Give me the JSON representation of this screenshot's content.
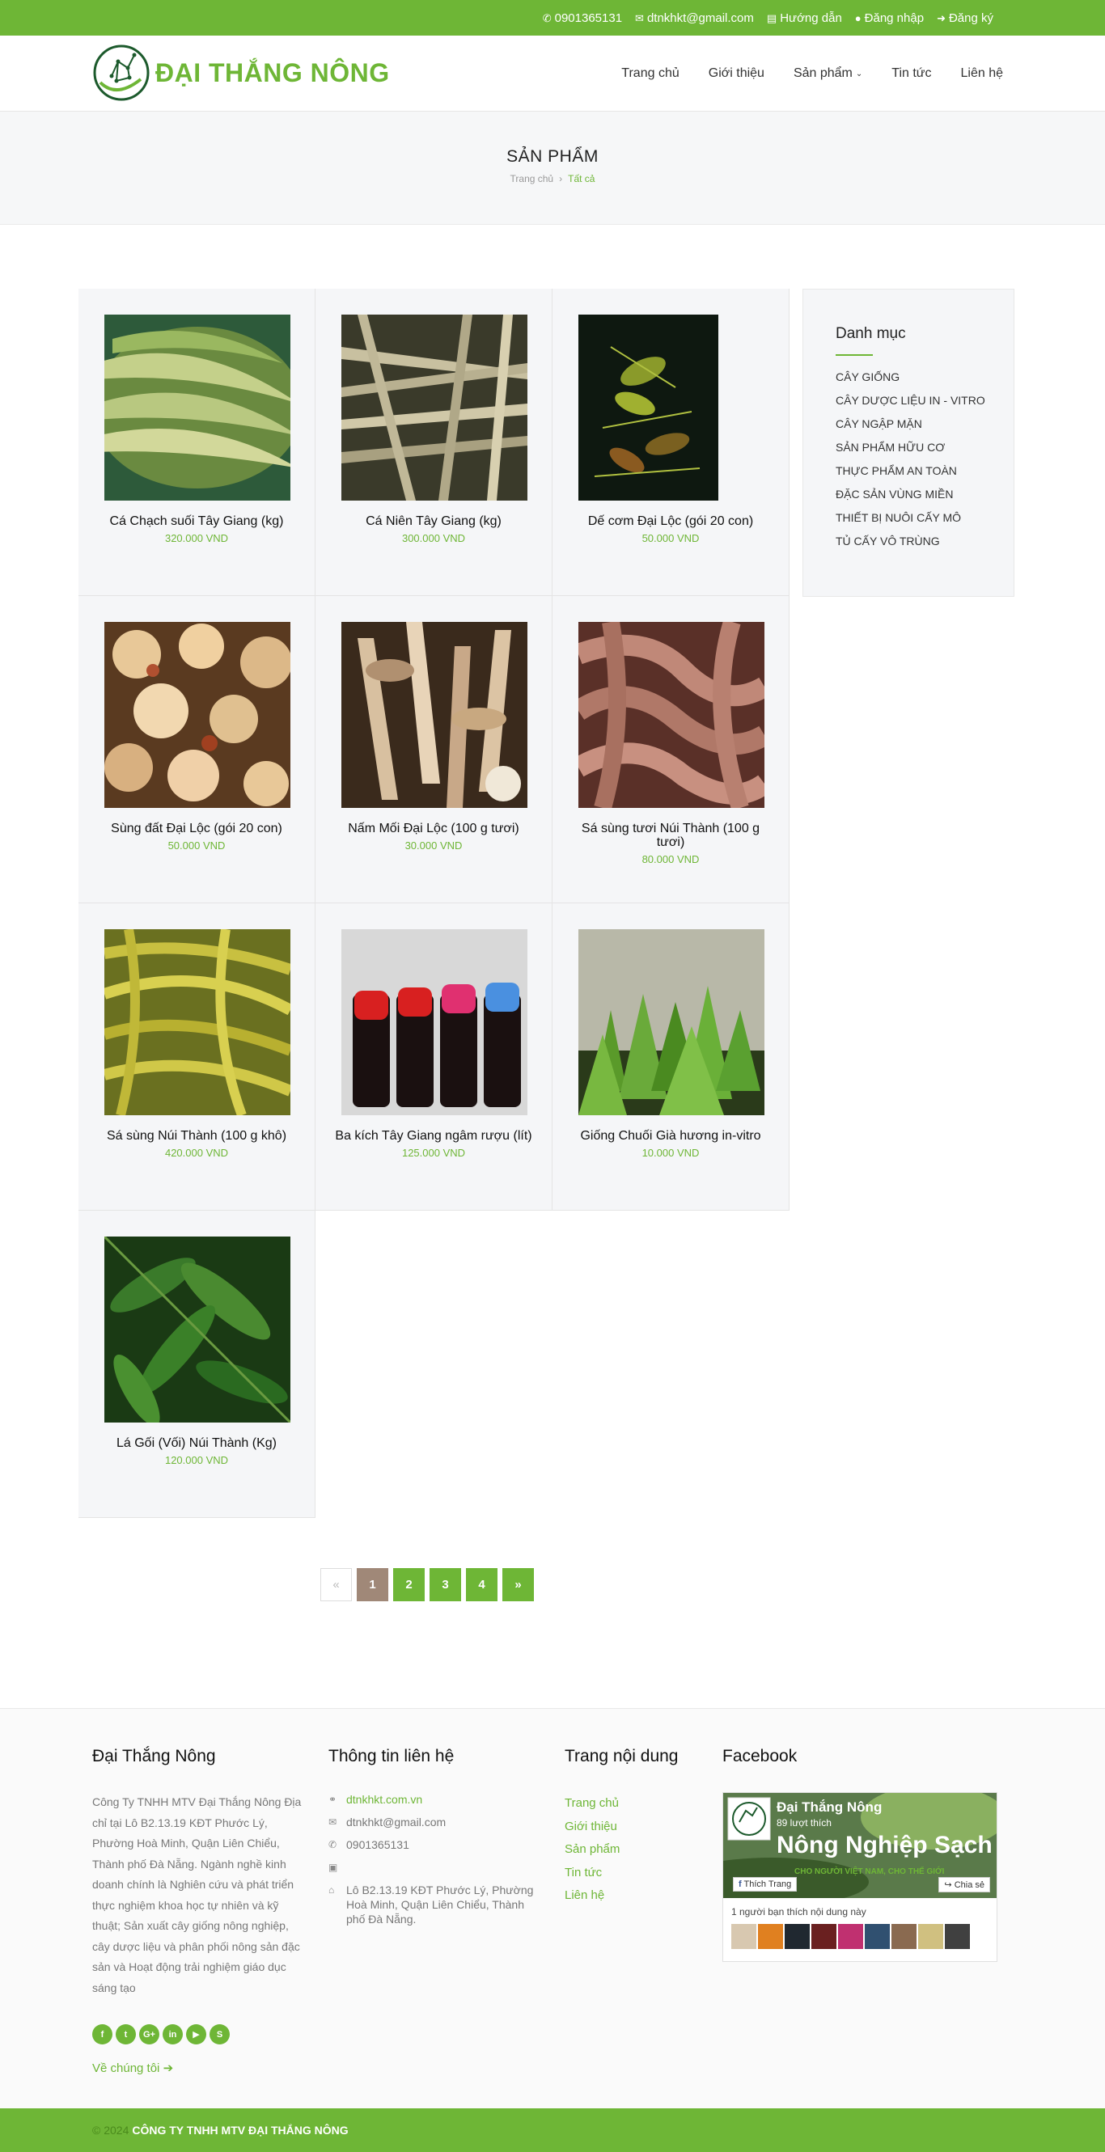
{
  "topbar": {
    "phone": "0901365131",
    "email": "dtnkhkt@gmail.com",
    "guide": "Hướng dẫn",
    "login": "Đăng nhập",
    "register": "Đăng ký"
  },
  "brand": {
    "name": "ĐẠI THẮNG NÔNG",
    "color": "#6eb636"
  },
  "nav": {
    "home": "Trang chủ",
    "about": "Giới thiệu",
    "products": "Sản phẩm",
    "news": "Tin tức",
    "contact": "Liên hệ"
  },
  "page": {
    "title": "SẢN PHẨM",
    "breadcrumb": {
      "home": "Trang chủ",
      "current": "Tất cả"
    }
  },
  "products": [
    {
      "name": "Cá Chạch suối Tây Giang (kg)",
      "price": "320.000 VND"
    },
    {
      "name": "Cá Niên Tây Giang (kg)",
      "price": "300.000 VND"
    },
    {
      "name": "Dế cơm Đại Lộc (gói 20 con)",
      "price": "50.000 VND"
    },
    {
      "name": "Sùng đất Đại Lộc (gói 20 con)",
      "price": "50.000 VND"
    },
    {
      "name": "Nấm Mối Đại Lộc (100 g tươi)",
      "price": "30.000 VND"
    },
    {
      "name": "Sá sùng tươi Núi Thành (100 g tươi)",
      "price": "80.000 VND"
    },
    {
      "name": "Sá sùng Núi Thành (100 g khô)",
      "price": "420.000 VND"
    },
    {
      "name": "Ba kích Tây Giang ngâm rượu (lít)",
      "price": "125.000 VND"
    },
    {
      "name": "Giống Chuối Già hương in-vitro",
      "price": "10.000 VND"
    },
    {
      "name": "Lá Gối (Vối) Núi Thành (Kg)",
      "price": "120.000 VND"
    }
  ],
  "sidebar": {
    "title": "Danh mục",
    "items": [
      "CÂY GIỐNG",
      "CÂY DƯỢC LIỆU IN - VITRO",
      "CÂY NGẬP MẶN",
      "SẢN PHẨM HỮU CƠ",
      "THỰC PHẨM AN TOÀN",
      "ĐẶC SẢN VÙNG MIỀN",
      "THIẾT BỊ NUÔI CẤY MÔ",
      "TỦ CẤY VÔ TRÙNG"
    ]
  },
  "pagination": {
    "prev": "«",
    "pages": [
      "1",
      "2",
      "3",
      "4"
    ],
    "next": "»",
    "current": "1"
  },
  "footer": {
    "about": {
      "title": "Đại Thắng Nông",
      "text": "Công Ty TNHH MTV Đại Thắng Nông Địa chỉ tại Lô B2.13.19 KĐT Phước Lý, Phường Hoà Minh, Quận Liên Chiểu, Thành phố Đà Nẵng. Ngành nghề kinh doanh chính là Nghiên cứu và phát triển thực nghiệm khoa học tự nhiên và kỹ thuật; Sản xuất cây giống nông nghiệp, cây dược liệu và phân phối nông sản đặc sản và Hoạt động trải nghiệm giáo dục sáng tạo",
      "more": "Về chúng tôi"
    },
    "contact": {
      "title": "Thông tin liên hệ",
      "website": "dtnkhkt.com.vn",
      "email": "dtnkhkt@gmail.com",
      "phone": "0901365131",
      "fax": "",
      "address": "Lô B2.13.19 KĐT Phước Lý, Phường Hoà Minh, Quận Liên Chiểu, Thành phố Đà Nẵng."
    },
    "pages": {
      "title": "Trang nội dung",
      "items": [
        "Trang chủ",
        "Giới thiệu",
        "Sản phẩm",
        "Tin tức",
        "Liên hệ"
      ]
    },
    "facebook": {
      "title": "Facebook",
      "page_name": "Đại Thắng Nông",
      "likes": "89 lượt thích",
      "banner": "Nông Nghiệp Sạch",
      "slogan": "CHO NGƯỜI VIỆT NAM, CHO THẾ GIỚI",
      "like_button": "Thích Trang",
      "share_button": "Chia sẻ",
      "friends": "1 người bạn thích nội dung này"
    }
  },
  "copyright": {
    "year": "© 2024",
    "company": "CÔNG TY TNHH MTV ĐẠI THẮNG NÔNG"
  }
}
